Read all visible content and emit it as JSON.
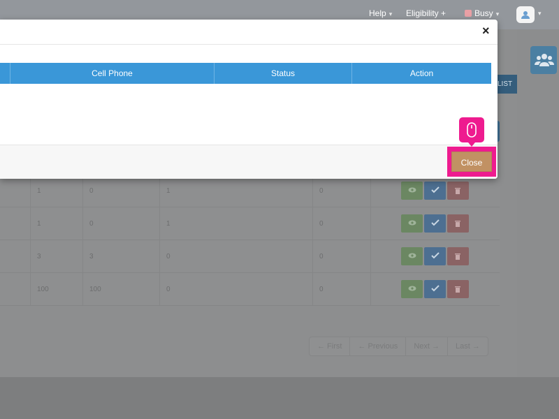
{
  "topbar": {
    "help_label": "Help",
    "eligibility_label": "Eligibility",
    "eligibility_suffix": "+",
    "status_label": "Busy",
    "caret": "▾"
  },
  "page": {
    "list_button_label": "LIST",
    "rows": [
      {
        "c1": "1",
        "c2": "0",
        "c3": "1",
        "c4": "0"
      },
      {
        "c1": "1",
        "c2": "0",
        "c3": "1",
        "c4": "0"
      },
      {
        "c1": "3",
        "c2": "3",
        "c3": "0",
        "c4": "0"
      },
      {
        "c1": "100",
        "c2": "100",
        "c3": "0",
        "c4": "0"
      }
    ],
    "pager": {
      "first": "← First",
      "previous": "← Previous",
      "next": "Next →",
      "last": "Last →"
    }
  },
  "modal": {
    "close_symbol": "×",
    "columns": [
      "Cell Phone",
      "Status",
      "Action"
    ],
    "footer_close_label": "Close"
  },
  "colors": {
    "header_blue": "#3a97d8",
    "highlight_pink": "#ee1b8f",
    "close_button": "#c19163"
  }
}
